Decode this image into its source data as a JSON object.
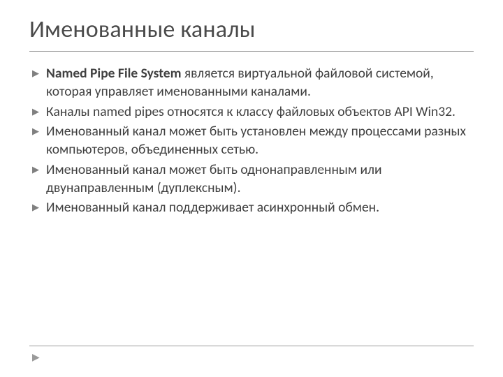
{
  "title": "Именованные каналы",
  "bullets": [
    {
      "bold": "Named Pipe File System",
      "rest": " является виртуальной файловой системой, которая управляет именованными каналами."
    },
    {
      "bold": "",
      "rest": "Каналы named pipes относятся к классу файловых объектов API Win32."
    },
    {
      "bold": "",
      "rest": "Именованный канал может быть установлен между процессами разных компьютеров, объединенных сетью."
    },
    {
      "bold": "",
      "rest": "Именованный канал может быть однонаправленным или двунаправленным (дуплексным)."
    },
    {
      "bold": "",
      "rest": "Именованный канал поддерживает асинхронный обмен."
    }
  ]
}
